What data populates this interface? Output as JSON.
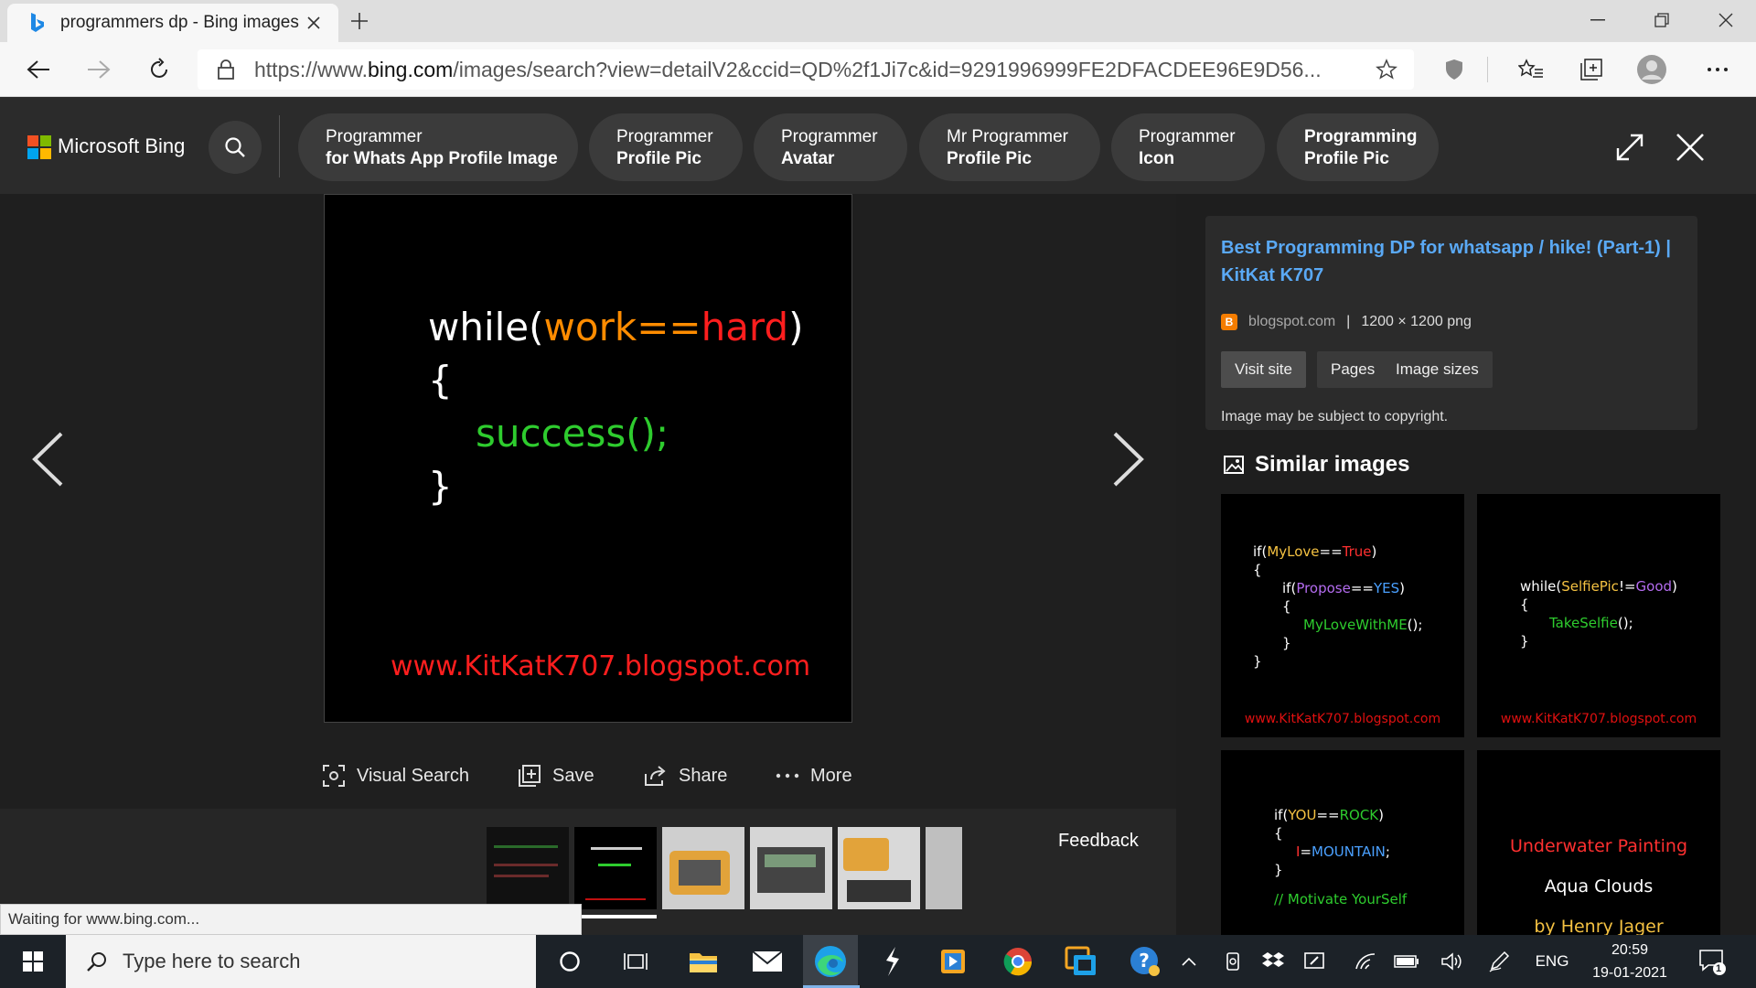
{
  "browser": {
    "tab_title": "programmers dp - Bing images",
    "url_prefix": "https://www.",
    "url_domain": "bing.com",
    "url_rest": "/images/search?view=detailV2&ccid=QD%2f1Ji7c&id=9291996999FE2DFACDEE96E9D56...",
    "status_text": "Waiting for www.bing.com..."
  },
  "bing": {
    "brand": "Microsoft Bing",
    "chips": [
      {
        "line1": "Programmer",
        "line2": "for Whats App Profile Image"
      },
      {
        "line1": "Programmer",
        "line2": "Profile Pic"
      },
      {
        "line1": "Programmer",
        "line2": "Avatar"
      },
      {
        "line1": "Mr Programmer",
        "line2": "Profile Pic"
      },
      {
        "line1": "Programmer",
        "line2": "Icon"
      },
      {
        "line1": "Programming",
        "line2": "Profile Pic"
      }
    ]
  },
  "main_image": {
    "line1_a": "while(",
    "line1_b": "work",
    "line1_c": "==",
    "line1_d": "hard",
    "line1_e": ")",
    "line2": "{",
    "line3": "success();",
    "line4": "}",
    "watermark": "www.KitKatK707.blogspot.com"
  },
  "actions": {
    "visual_search": "Visual Search",
    "save": "Save",
    "share": "Share",
    "more": "More"
  },
  "feedback": "Feedback",
  "info": {
    "title": "Best Programming DP for whatsapp / hike! (Part-1) | KitKat K707",
    "domain": "blogspot.com",
    "separator": "|",
    "dimensions": "1200 × 1200 png",
    "buttons": [
      "Visit site",
      "Pages",
      "Image sizes"
    ],
    "copyright": "Image may be subject to copyright."
  },
  "similar": {
    "heading": "Similar images",
    "img1": {
      "l1a": "if(",
      "l1b": "MyLove",
      "l1c": "==",
      "l1d": "True",
      "l1e": ")",
      "l2": "{",
      "l3a": "if(",
      "l3b": "Propose",
      "l3c": "==",
      "l3d": "YES",
      "l3e": ")",
      "l4": "{",
      "l5": "MyLoveWithME",
      "l5b": "();",
      "l6": "}",
      "l7": "}",
      "url": "www.KitKatK707.blogspot.com"
    },
    "img2": {
      "l1a": "while(",
      "l1b": "SelfiePic",
      "l1c": "!=",
      "l1d": "Good",
      "l1e": ")",
      "l2": "{",
      "l3": "TakeSelfie",
      "l3b": "();",
      "l4": "}",
      "url": "www.KitKatK707.blogspot.com"
    },
    "img3": {
      "l1a": "if(",
      "l1b": "YOU",
      "l1c": "==",
      "l1d": "ROCK",
      "l1e": ")",
      "l2": "{",
      "l3a": "I",
      "l3b": "=",
      "l3c": "MOUNTAIN",
      "l3d": ";",
      "l4": "}",
      "l5": "// Motivate YourSelf"
    },
    "img4": {
      "l1": "Underwater Painting",
      "l2": "Aqua Clouds",
      "l3": "by Henry Jager"
    }
  },
  "taskbar": {
    "search_placeholder": "Type here to search",
    "language": "ENG",
    "time": "20:59",
    "date": "19-01-2021",
    "notification_count": "1"
  },
  "colors": {
    "accent_blue": "#5aa9f5",
    "code_orange": "#ff8c00",
    "code_red": "#ff1e1e",
    "code_green": "#2ecc2e"
  }
}
